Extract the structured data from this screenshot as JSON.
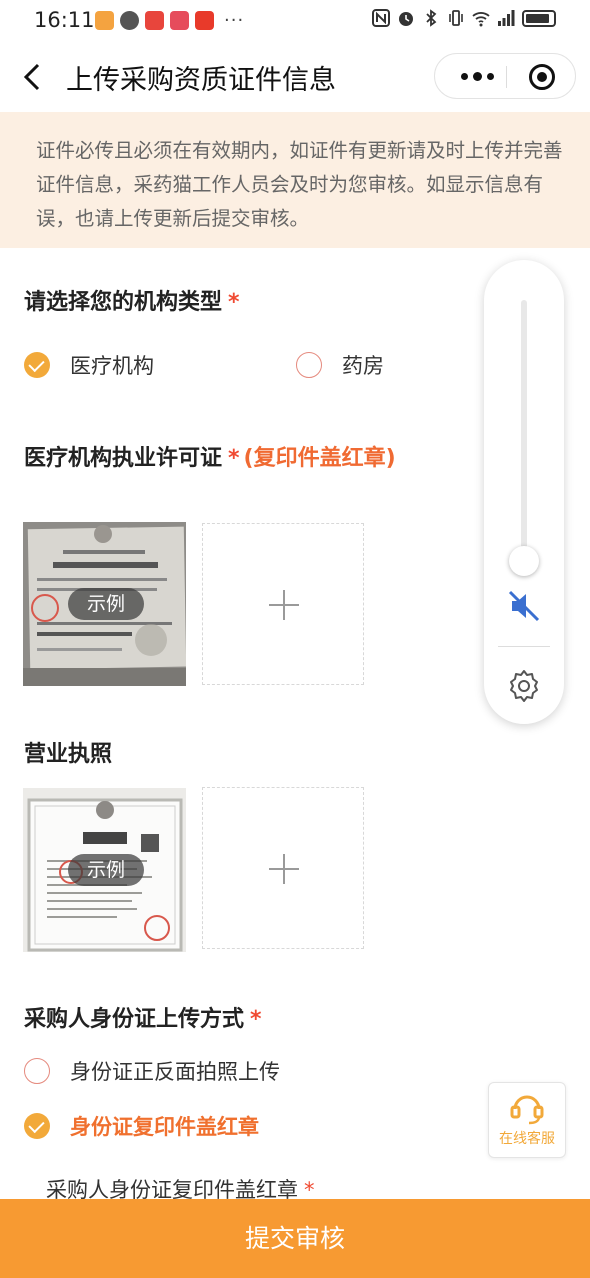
{
  "status_bar": {
    "time": "16:11",
    "more": "···"
  },
  "header": {
    "title": "上传采购资质证件信息"
  },
  "notice": {
    "text": "证件必传且必须在有效期内，如证件有更新请及时上传并完善证件信息，采药猫工作人员会及时为您审核。如显示信息有误，也请上传更新后提交审核。"
  },
  "org_type": {
    "label": "请选择您的机构类型",
    "required_mark": "*",
    "options": [
      {
        "label": "医疗机构",
        "checked": true
      },
      {
        "label": "药房",
        "checked": false
      }
    ]
  },
  "medical_license": {
    "label": "医疗机构执业许可证",
    "required_mark": "*",
    "hint": "(复印件盖红章)",
    "sample_badge": "示例"
  },
  "business_license": {
    "label": "营业执照",
    "sample_badge": "示例"
  },
  "id_upload": {
    "label": "采购人身份证上传方式",
    "required_mark": "*",
    "options": [
      {
        "label": "身份证正反面拍照上传",
        "checked": false
      },
      {
        "label": "身份证复印件盖红章",
        "checked": true
      }
    ],
    "subfield_label": "采购人身份证复印件盖红章",
    "subfield_required_mark": "*"
  },
  "float_panel": {
    "volume_level": 0.0,
    "muted": true
  },
  "service_button": {
    "label": "在线客服"
  },
  "submit_button": {
    "label": "提交审核"
  },
  "colors": {
    "accent": "#f79a32",
    "required": "#f04a32",
    "notice_bg": "#fcefe2",
    "checked": "#f2a93a"
  }
}
